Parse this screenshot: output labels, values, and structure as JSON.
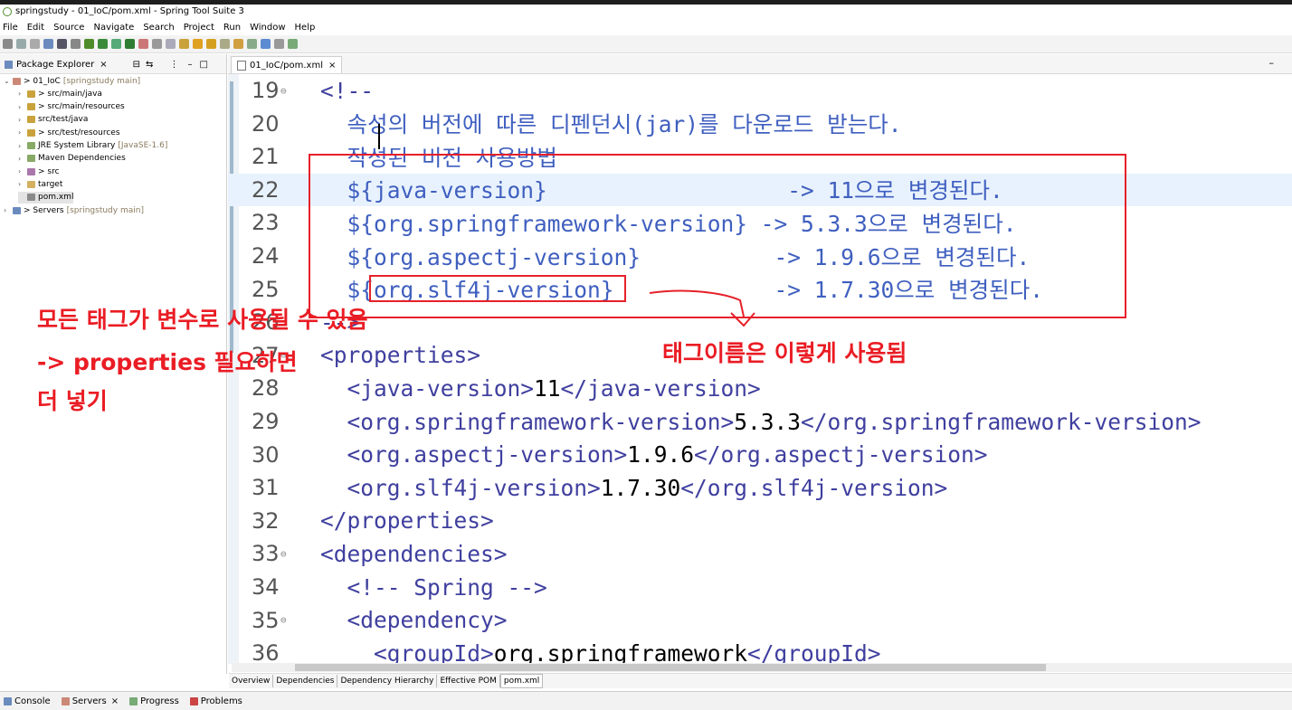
{
  "window": {
    "title": "springstudy - 01_IoC/pom.xml - Spring Tool Suite 3"
  },
  "menu": [
    "File",
    "Edit",
    "Source",
    "Navigate",
    "Search",
    "Project",
    "Run",
    "Window",
    "Help"
  ],
  "package_explorer": {
    "tab_label": "Package Explorer",
    "tree": [
      {
        "label": "> 01_IoC",
        "extra": "[springstudy main]"
      },
      {
        "label": "> src/main/java",
        "extra": ""
      },
      {
        "label": "> src/main/resources",
        "extra": ""
      },
      {
        "label": "src/test/java",
        "extra": ""
      },
      {
        "label": "> src/test/resources",
        "extra": ""
      },
      {
        "label": "JRE System Library",
        "extra": "[JavaSE-1.6]"
      },
      {
        "label": "Maven Dependencies",
        "extra": ""
      },
      {
        "label": "> src",
        "extra": ""
      },
      {
        "label": "target",
        "extra": ""
      },
      {
        "label": "pom.xml",
        "extra": ""
      },
      {
        "label": "> Servers",
        "extra": "[springstudy main]"
      }
    ]
  },
  "editor": {
    "tab_label": "01_IoC/pom.xml",
    "lines": [
      {
        "num": "19",
        "fold": "⊖",
        "parts": [
          [
            "tag",
            "<!--"
          ]
        ]
      },
      {
        "num": "20",
        "fold": "",
        "parts": [
          [
            "cmt",
            "  속성의 버전에 따른 디펜던시(jar)를 다운로드 받는다."
          ]
        ]
      },
      {
        "num": "21",
        "fold": "",
        "parts": [
          [
            "cmt",
            "  작성된 비전 사용방법"
          ]
        ]
      },
      {
        "num": "22",
        "fold": "",
        "parts": [
          [
            "cmt",
            "  ${java-version}                  -> 11으로 변경된다."
          ]
        ]
      },
      {
        "num": "23",
        "fold": "",
        "parts": [
          [
            "cmt",
            "  ${org.springframework-version} -> 5.3.3으로 변경된다."
          ]
        ]
      },
      {
        "num": "24",
        "fold": "",
        "parts": [
          [
            "cmt",
            "  ${org.aspectj-version}          -> 1.9.6으로 변경된다."
          ]
        ]
      },
      {
        "num": "25",
        "fold": "",
        "parts": [
          [
            "cmt",
            "  ${org.slf4j-version}            -> 1.7.30으로 변경된다."
          ]
        ]
      },
      {
        "num": "26",
        "fold": "",
        "parts": [
          [
            "tag",
            "-->"
          ]
        ]
      },
      {
        "num": "27",
        "fold": "⊖",
        "parts": [
          [
            "tag",
            "<properties>"
          ]
        ]
      },
      {
        "num": "28",
        "fold": "",
        "parts": [
          [
            "tag",
            "  <java-version>"
          ],
          [
            "txt",
            "11"
          ],
          [
            "tag",
            "</java-version>"
          ]
        ]
      },
      {
        "num": "29",
        "fold": "",
        "parts": [
          [
            "tag",
            "  <org.springframework-version>"
          ],
          [
            "txt",
            "5.3.3"
          ],
          [
            "tag",
            "</org.springframework-version>"
          ]
        ]
      },
      {
        "num": "30",
        "fold": "",
        "parts": [
          [
            "tag",
            "  <org.aspectj-version>"
          ],
          [
            "txt",
            "1.9.6"
          ],
          [
            "tag",
            "</org.aspectj-version>"
          ]
        ]
      },
      {
        "num": "31",
        "fold": "",
        "parts": [
          [
            "tag",
            "  <org.slf4j-version>"
          ],
          [
            "txt",
            "1.7.30"
          ],
          [
            "tag",
            "</org.slf4j-version>"
          ]
        ]
      },
      {
        "num": "32",
        "fold": "",
        "parts": [
          [
            "tag",
            "</properties>"
          ]
        ]
      },
      {
        "num": "33",
        "fold": "⊖",
        "parts": [
          [
            "tag",
            "<dependencies>"
          ]
        ]
      },
      {
        "num": "34",
        "fold": "",
        "parts": [
          [
            "tag",
            "  <!-- Spring -->"
          ]
        ]
      },
      {
        "num": "35",
        "fold": "⊖",
        "parts": [
          [
            "tag",
            "  <dependency>"
          ]
        ]
      },
      {
        "num": "36",
        "fold": "",
        "parts": [
          [
            "tag",
            "    <groupId>"
          ],
          [
            "txt",
            "org.springframework"
          ],
          [
            "tag",
            "</groupId>"
          ]
        ]
      }
    ]
  },
  "annotations": {
    "left_line1": "모든 태그가 변수로 사용될 수 있음",
    "left_line2": "-> properties 필요하면",
    "left_line3": "더 넣기",
    "right_note": "태그이름은 이렇게 사용됨"
  },
  "pom_tabs": [
    "Overview",
    "Dependencies",
    "Dependency Hierarchy",
    "Effective POM",
    "pom.xml"
  ],
  "bottom_tabs": [
    "Console",
    "Servers",
    "Progress",
    "Problems"
  ]
}
